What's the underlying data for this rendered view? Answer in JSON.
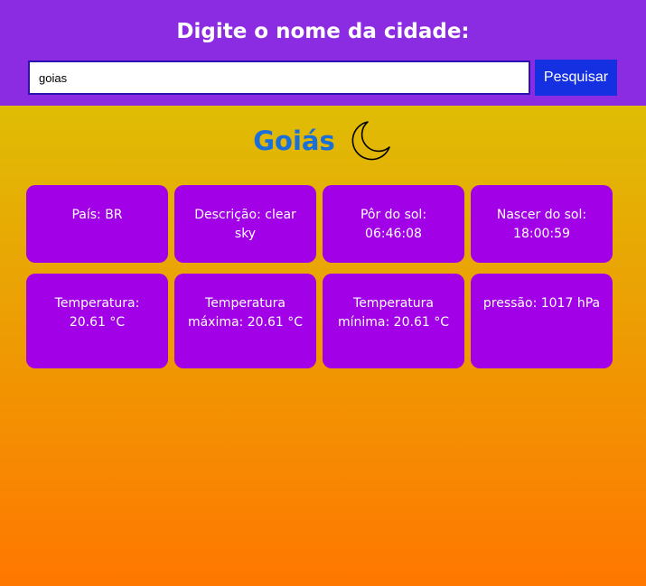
{
  "header": {
    "title": "Digite o nome da cidade:",
    "search_value": "goias",
    "search_button": "Pesquisar"
  },
  "city": {
    "name": "Goiás",
    "icon": "moon-icon"
  },
  "cards": [
    {
      "text": "País: BR"
    },
    {
      "text": "Descrição: clear sky"
    },
    {
      "text": "Pôr do sol: 06:46:08"
    },
    {
      "text": "Nascer do sol: 18:00:59"
    },
    {
      "text": "Temperatura: 20.61 °C"
    },
    {
      "text": "Temperatura máxima: 20.61 °C"
    },
    {
      "text": "Temperatura mínima: 20.61 °C"
    },
    {
      "text": "pressão: 1017 hPa"
    }
  ],
  "colors": {
    "header_bg": "#8b2be2",
    "button_bg": "#1530e0",
    "card_bg": "#a200e6",
    "city_name": "#1a6fd8",
    "gradient_top": "#d9cc06",
    "gradient_bottom": "#ff7700"
  }
}
